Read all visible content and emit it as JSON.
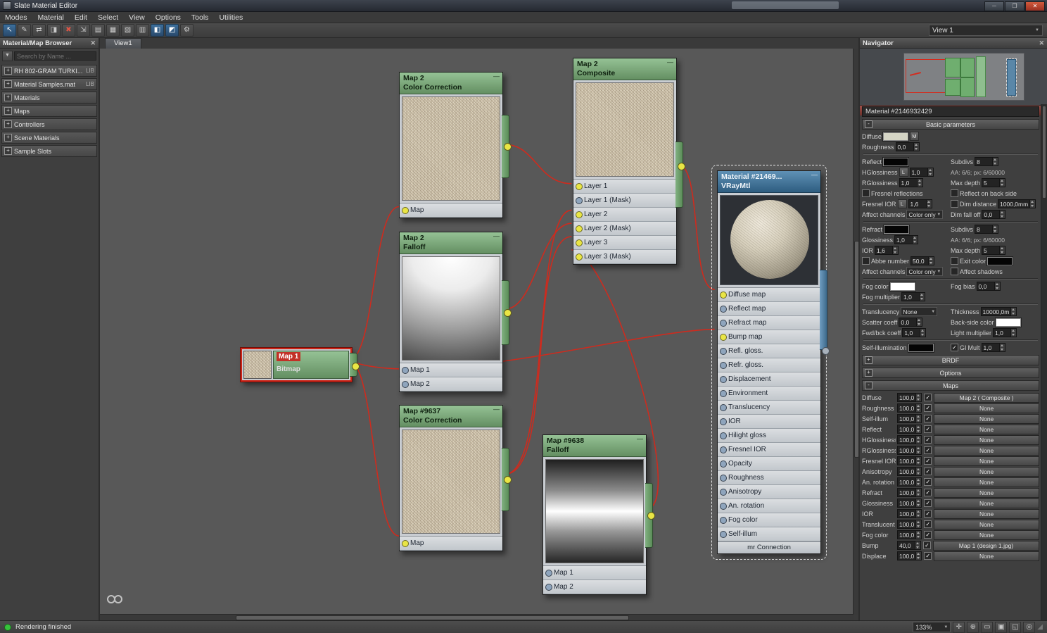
{
  "window": {
    "title": "Slate Material Editor"
  },
  "menubar": {
    "items": [
      "Modes",
      "Material",
      "Edit",
      "Select",
      "View",
      "Options",
      "Tools",
      "Utilities"
    ]
  },
  "toolbar": {
    "view_selector": "View 1",
    "buttons": [
      {
        "name": "select-tool",
        "glyph": "↖",
        "state": "active"
      },
      {
        "name": "pick-material-from-object-tool",
        "glyph": "✎",
        "state": ""
      },
      {
        "name": "put-material-to-scene-tool",
        "glyph": "⇄",
        "state": ""
      },
      {
        "name": "assign-material-to-selection-tool",
        "glyph": "◨",
        "state": ""
      },
      {
        "name": "delete-selected-tool",
        "glyph": "✖",
        "state": "danger"
      },
      {
        "name": "move-children-tool",
        "glyph": "⇲",
        "state": ""
      },
      {
        "name": "hide-unused-nodeslots-tool",
        "glyph": "▤",
        "state": ""
      },
      {
        "name": "show-background-tool",
        "glyph": "▦",
        "state": ""
      },
      {
        "name": "layout-all-tool",
        "glyph": "▧",
        "state": ""
      },
      {
        "name": "layout-children-tool",
        "glyph": "▥",
        "state": ""
      },
      {
        "name": "show-shaded-material-in-viewport-tool",
        "glyph": "◧",
        "state": "active"
      },
      {
        "name": "show-realistic-material-in-viewport-tool",
        "glyph": "◩",
        "state": "active"
      },
      {
        "name": "material-id-channel-tool",
        "glyph": "⚙",
        "state": ""
      }
    ]
  },
  "browser": {
    "title": "Material/Map Browser",
    "search_placeholder": "Search by Name ...",
    "items": [
      {
        "label": "RH 802-GRAM TURKI...",
        "tag": "LIB"
      },
      {
        "label": "Material Samples.mat",
        "tag": "LIB"
      },
      {
        "label": "Materials",
        "tag": ""
      },
      {
        "label": "Maps",
        "tag": ""
      },
      {
        "label": "Controllers",
        "tag": ""
      },
      {
        "label": "Scene Materials",
        "tag": ""
      },
      {
        "label": "Sample Slots",
        "tag": ""
      }
    ]
  },
  "view": {
    "tab": "View1"
  },
  "nodes": {
    "cc1": {
      "title": "Map 2",
      "subtitle": "Color Correction",
      "slots": [
        {
          "label": "Map",
          "connected": true
        }
      ]
    },
    "composite": {
      "title": "Map 2",
      "subtitle": "Composite",
      "slots": [
        {
          "label": "Layer 1",
          "connected": true
        },
        {
          "label": "Layer 1 (Mask)",
          "connected": false
        },
        {
          "label": "Layer 2",
          "connected": true
        },
        {
          "label": "Layer 2 (Mask)",
          "connected": true
        },
        {
          "label": "Layer 3",
          "connected": true
        },
        {
          "label": "Layer 3 (Mask)",
          "connected": true
        }
      ]
    },
    "falloff1": {
      "title": "Map 2",
      "subtitle": "Falloff",
      "slots": [
        {
          "label": "Map 1",
          "connected": false
        },
        {
          "label": "Map 2",
          "connected": false
        }
      ]
    },
    "bitmap": {
      "title": "Map 1",
      "subtitle": "Bitmap"
    },
    "cc2": {
      "title": "Map #9637",
      "subtitle": "Color Correction",
      "slots": [
        {
          "label": "Map",
          "connected": true
        }
      ]
    },
    "falloff2": {
      "title": "Map #9638",
      "subtitle": "Falloff",
      "slots": [
        {
          "label": "Map 1",
          "connected": false
        },
        {
          "label": "Map 2",
          "connected": false
        }
      ]
    },
    "material": {
      "title": "Material  #21469...",
      "subtitle": "VRayMtl",
      "footer": "mr Connection",
      "slots": [
        {
          "label": "Diffuse map",
          "connected": true
        },
        {
          "label": "Reflect map",
          "connected": false
        },
        {
          "label": "Refract map",
          "connected": false
        },
        {
          "label": "Bump map",
          "connected": true
        },
        {
          "label": "Refl. gloss.",
          "connected": false
        },
        {
          "label": "Refr. gloss.",
          "connected": false
        },
        {
          "label": "Displacement",
          "connected": false
        },
        {
          "label": "Environment",
          "connected": false
        },
        {
          "label": "Translucency",
          "connected": false
        },
        {
          "label": "IOR",
          "connected": false
        },
        {
          "label": "Hilight gloss",
          "connected": false
        },
        {
          "label": "Fresnel IOR",
          "connected": false
        },
        {
          "label": "Opacity",
          "connected": false
        },
        {
          "label": "Roughness",
          "connected": false
        },
        {
          "label": "Anisotropy",
          "connected": false
        },
        {
          "label": "An. rotation",
          "connected": false
        },
        {
          "label": "Fog color",
          "connected": false
        },
        {
          "label": "Self-illum",
          "connected": false
        }
      ]
    }
  },
  "connections": [
    {
      "from": "bitmap",
      "to": "cc1.Map"
    },
    {
      "from": "bitmap",
      "to": "cc2.Map"
    },
    {
      "from": "bitmap",
      "to": "material.Bump map"
    },
    {
      "from": "cc1",
      "to": "composite.Layer 1"
    },
    {
      "from": "cc2",
      "to": "composite.Layer 2"
    },
    {
      "from": "falloff1",
      "to": "composite.Layer 2 (Mask)"
    },
    {
      "from": "cc2",
      "to": "composite.Layer 3"
    },
    {
      "from": "falloff2",
      "to": "composite.Layer 3 (Mask)"
    },
    {
      "from": "composite",
      "to": "material.Diffuse map"
    }
  ],
  "navigator": {
    "title": "Navigator"
  },
  "params": {
    "header": "Material #2146932429  ( VRayMtl )",
    "name_field": "Material #2146932429",
    "rollouts": {
      "basic": "Basic parameters",
      "brdf": "BRDF",
      "options": "Options",
      "maps": "Maps"
    },
    "basic_rows": [
      {
        "l": [
          {
            "t": "lbl",
            "v": "Diffuse"
          },
          {
            "t": "sw",
            "c": "#d5d5c5"
          },
          {
            "t": "btn",
            "v": "M"
          }
        ],
        "r": []
      },
      {
        "l": [
          {
            "t": "lbl",
            "v": "Roughness"
          },
          {
            "t": "sp",
            "v": "0,0"
          }
        ],
        "r": []
      },
      {
        "sep": true
      },
      {
        "l": [
          {
            "t": "lbl",
            "v": "Reflect"
          },
          {
            "t": "sw",
            "c": "#050505"
          }
        ],
        "r": [
          {
            "t": "lbl",
            "v": "Subdivs"
          },
          {
            "t": "sp",
            "v": "8"
          }
        ]
      },
      {
        "l": [
          {
            "t": "lbl",
            "v": "HGlossiness"
          },
          {
            "t": "btn",
            "v": "L"
          },
          {
            "t": "sp",
            "v": "1,0"
          }
        ],
        "r": [
          {
            "t": "txt",
            "v": "AA: 6/6; px: 6/60000"
          }
        ]
      },
      {
        "l": [
          {
            "t": "lbl",
            "v": "RGlossiness"
          },
          {
            "t": "sp",
            "v": "1,0"
          }
        ],
        "r": [
          {
            "t": "lbl",
            "v": "Max depth"
          },
          {
            "t": "sp",
            "v": "5"
          }
        ]
      },
      {
        "l": [
          {
            "t": "chk",
            "v": "Fresnel reflections",
            "on": false
          }
        ],
        "r": [
          {
            "t": "chk",
            "v": "Reflect on back side",
            "on": false
          }
        ]
      },
      {
        "l": [
          {
            "t": "lbl",
            "v": "Fresnel IOR"
          },
          {
            "t": "btn",
            "v": "L"
          },
          {
            "t": "sp",
            "v": "1,6"
          }
        ],
        "r": [
          {
            "t": "chk",
            "v": "Dim distance",
            "on": false
          },
          {
            "t": "sp",
            "v": "1000,0mm"
          }
        ]
      },
      {
        "l": [
          {
            "t": "lbl",
            "v": "Affect channels"
          },
          {
            "t": "dd",
            "v": "Color only"
          }
        ],
        "r": [
          {
            "t": "lbl",
            "v": "Dim fall off"
          },
          {
            "t": "sp",
            "v": "0,0"
          }
        ]
      },
      {
        "sep": true
      },
      {
        "l": [
          {
            "t": "lbl",
            "v": "Refract"
          },
          {
            "t": "sw",
            "c": "#050505"
          }
        ],
        "r": [
          {
            "t": "lbl",
            "v": "Subdivs"
          },
          {
            "t": "sp",
            "v": "8"
          }
        ]
      },
      {
        "l": [
          {
            "t": "lbl",
            "v": "Glossiness"
          },
          {
            "t": "sp",
            "v": "1,0"
          }
        ],
        "r": [
          {
            "t": "txt",
            "v": "AA: 6/6; px: 6/60000"
          }
        ]
      },
      {
        "l": [
          {
            "t": "lbl",
            "v": "IOR"
          },
          {
            "t": "sp",
            "v": "1,6"
          }
        ],
        "r": [
          {
            "t": "lbl",
            "v": "Max depth"
          },
          {
            "t": "sp",
            "v": "5"
          }
        ]
      },
      {
        "l": [
          {
            "t": "chk",
            "v": "Abbe number",
            "on": false
          },
          {
            "t": "sp",
            "v": "50,0"
          }
        ],
        "r": [
          {
            "t": "chk",
            "v": "Exit color",
            "on": false
          },
          {
            "t": "sw",
            "c": "#050505"
          }
        ]
      },
      {
        "l": [
          {
            "t": "lbl",
            "v": "Affect channels"
          },
          {
            "t": "dd",
            "v": "Color only"
          }
        ],
        "r": [
          {
            "t": "chk",
            "v": "Affect shadows",
            "on": false
          }
        ]
      },
      {
        "sep": true
      },
      {
        "l": [
          {
            "t": "lbl",
            "v": "Fog color"
          },
          {
            "t": "sw",
            "c": "#ffffff"
          }
        ],
        "r": [
          {
            "t": "lbl",
            "v": "Fog bias"
          },
          {
            "t": "sp",
            "v": "0,0"
          }
        ]
      },
      {
        "l": [
          {
            "t": "lbl",
            "v": "Fog multiplier"
          },
          {
            "t": "sp",
            "v": "1,0"
          }
        ],
        "r": []
      },
      {
        "sep": true
      },
      {
        "l": [
          {
            "t": "lbl",
            "v": "Translucency"
          },
          {
            "t": "dd",
            "v": "None"
          }
        ],
        "r": [
          {
            "t": "lbl",
            "v": "Thickness"
          },
          {
            "t": "sp",
            "v": "10000,0m"
          }
        ]
      },
      {
        "l": [
          {
            "t": "lbl",
            "v": "Scatter coeff"
          },
          {
            "t": "sp",
            "v": "0,0"
          }
        ],
        "r": [
          {
            "t": "lbl",
            "v": "Back-side color"
          },
          {
            "t": "sw",
            "c": "#ffffff"
          }
        ]
      },
      {
        "l": [
          {
            "t": "lbl",
            "v": "Fwd/bck coeff"
          },
          {
            "t": "sp",
            "v": "1,0"
          }
        ],
        "r": [
          {
            "t": "lbl",
            "v": "Light multiplier"
          },
          {
            "t": "sp",
            "v": "1,0"
          }
        ]
      },
      {
        "sep": true
      },
      {
        "l": [
          {
            "t": "lbl",
            "v": "Self-illumination"
          },
          {
            "t": "sw",
            "c": "#050505"
          }
        ],
        "r": [
          {
            "t": "chk",
            "v": "GI",
            "on": true
          },
          {
            "t": "lbl",
            "v": "Mult"
          },
          {
            "t": "sp",
            "v": "1,0"
          }
        ]
      }
    ],
    "maps_rows": [
      {
        "label": "Diffuse",
        "amount": "100,0",
        "checked": true,
        "map": "Map 2  ( Composite )"
      },
      {
        "label": "Roughness",
        "amount": "100,0",
        "checked": true,
        "map": "None"
      },
      {
        "label": "Self-illum",
        "amount": "100,0",
        "checked": true,
        "map": "None"
      },
      {
        "label": "Reflect",
        "amount": "100,0",
        "checked": true,
        "map": "None"
      },
      {
        "label": "HGlossiness",
        "amount": "100,0",
        "checked": true,
        "map": "None"
      },
      {
        "label": "RGlossiness",
        "amount": "100,0",
        "checked": true,
        "map": "None"
      },
      {
        "label": "Fresnel IOR",
        "amount": "100,0",
        "checked": true,
        "map": "None"
      },
      {
        "label": "Anisotropy",
        "amount": "100,0",
        "checked": true,
        "map": "None"
      },
      {
        "label": "An. rotation",
        "amount": "100,0",
        "checked": true,
        "map": "None"
      },
      {
        "label": "Refract",
        "amount": "100,0",
        "checked": true,
        "map": "None"
      },
      {
        "label": "Glossiness",
        "amount": "100,0",
        "checked": true,
        "map": "None"
      },
      {
        "label": "IOR",
        "amount": "100,0",
        "checked": true,
        "map": "None"
      },
      {
        "label": "Translucent",
        "amount": "100,0",
        "checked": true,
        "map": "None"
      },
      {
        "label": "Fog color",
        "amount": "100,0",
        "checked": true,
        "map": "None"
      },
      {
        "label": "Bump",
        "amount": "40,0",
        "checked": true,
        "map": "Map 1 (design 1.jpg)"
      },
      {
        "label": "Displace",
        "amount": "100,0",
        "checked": true,
        "map": "None"
      }
    ]
  },
  "statusbar": {
    "status": "Rendering finished",
    "zoom": "133%",
    "icons": [
      {
        "name": "pan-tool",
        "glyph": "✛"
      },
      {
        "name": "zoom-tool",
        "glyph": "⊕"
      },
      {
        "name": "zoom-region-tool",
        "glyph": "▭"
      },
      {
        "name": "zoom-extents-tool",
        "glyph": "▣"
      },
      {
        "name": "zoom-extents-selected-tool",
        "glyph": "◱"
      },
      {
        "name": "pan-to-selected-tool",
        "glyph": "◎"
      }
    ]
  }
}
